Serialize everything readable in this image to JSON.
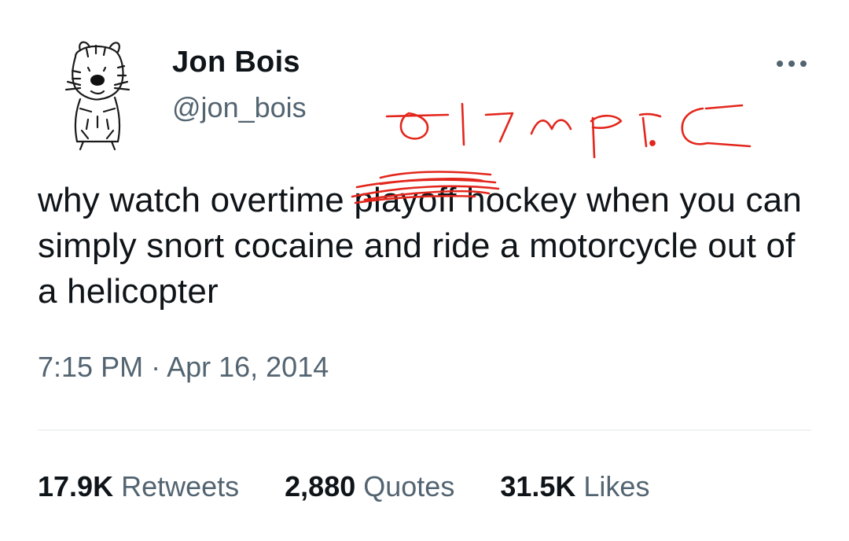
{
  "author": {
    "name": "Jon Bois",
    "handle": "@jon_bois",
    "avatar_icon": "hobbes-drawing-avatar"
  },
  "more_icon": "more-dots-icon",
  "annotation": {
    "handwritten": "olympic",
    "color": "#e3261c"
  },
  "tweet": {
    "before": "why watch overtime ",
    "struck_word": "playoff",
    "after": " hockey when you can simply snort cocaine and ride a motorcycle out of a helicopter"
  },
  "timestamp": {
    "time": "7:15 PM",
    "separator": " · ",
    "date": "Apr 16, 2014"
  },
  "stats": [
    {
      "count": "17.9K",
      "label": "Retweets"
    },
    {
      "count": "2,880",
      "label": "Quotes"
    },
    {
      "count": "31.5K",
      "label": "Likes"
    }
  ]
}
